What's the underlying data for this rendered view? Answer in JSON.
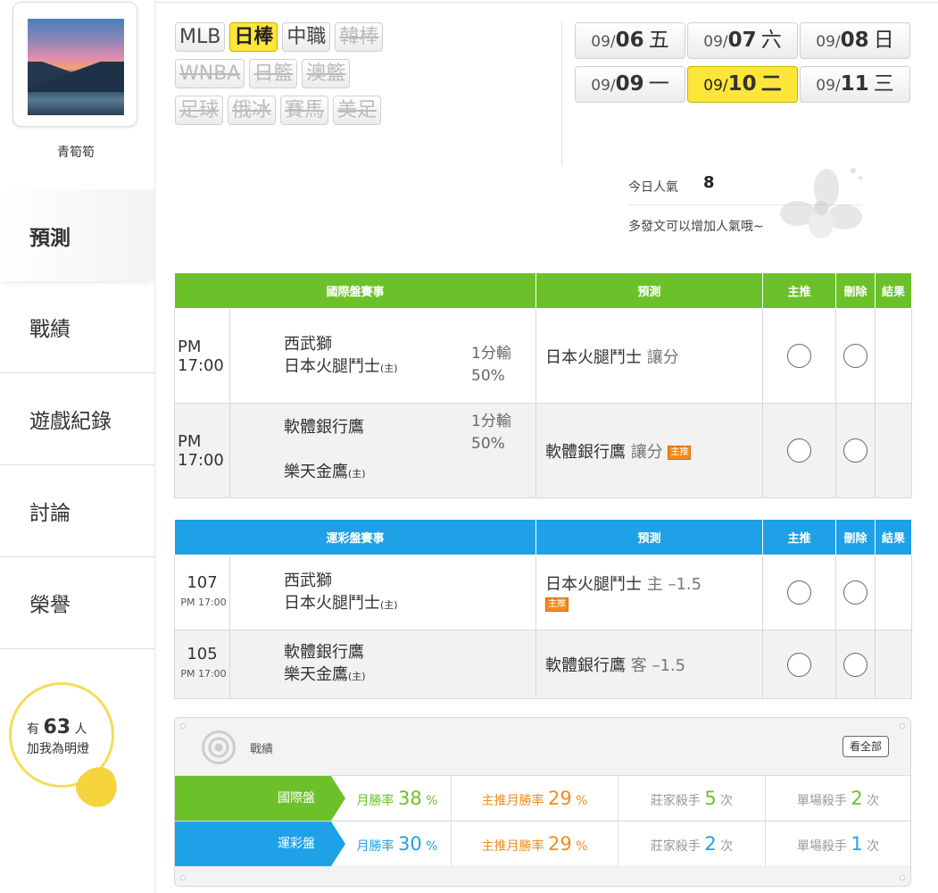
{
  "profile": {
    "username": "青筍筍"
  },
  "sidebar": {
    "items": [
      {
        "label": "預測",
        "active": true
      },
      {
        "label": "戰績"
      },
      {
        "label": "遊戲紀錄"
      },
      {
        "label": "討論"
      },
      {
        "label": "榮譽"
      }
    ],
    "fans": {
      "prefix": "有",
      "count": "63",
      "suffix": "人",
      "line2": "加我為明燈"
    }
  },
  "sports": [
    {
      "label": "MLB",
      "state": "normal"
    },
    {
      "label": "日棒",
      "state": "active"
    },
    {
      "label": "中職",
      "state": "normal"
    },
    {
      "label": "韓棒",
      "state": "disabled"
    },
    {
      "label": "WNBA",
      "state": "disabled"
    },
    {
      "label": "日籃",
      "state": "disabled"
    },
    {
      "label": "澳籃",
      "state": "disabled"
    },
    {
      "label": "足球",
      "state": "disabled"
    },
    {
      "label": "俄冰",
      "state": "disabled"
    },
    {
      "label": "賽馬",
      "state": "disabled"
    },
    {
      "label": "美足",
      "state": "disabled"
    }
  ],
  "dates": [
    {
      "month": "09/",
      "day": "06",
      "weekday": "五",
      "active": false
    },
    {
      "month": "09/",
      "day": "07",
      "weekday": "六",
      "active": false
    },
    {
      "month": "09/",
      "day": "08",
      "weekday": "日",
      "active": false
    },
    {
      "month": "09/",
      "day": "09",
      "weekday": "一",
      "active": false
    },
    {
      "month": "09/",
      "day": "10",
      "weekday": "二",
      "active": true
    },
    {
      "month": "09/",
      "day": "11",
      "weekday": "三",
      "active": false
    }
  ],
  "popularity": {
    "label": "今日人氣",
    "value": "8",
    "hint": "多發文可以增加人氣哦~"
  },
  "intl": {
    "headers": {
      "event": "國際盤賽事",
      "prediction": "預測",
      "main": "主推",
      "delete": "刪除",
      "result": "結果"
    },
    "rows": [
      {
        "time": "PM 17:00",
        "team1": "西武獅",
        "team1_host": "",
        "team2": "日本火腿鬥士",
        "team2_host": "(主)",
        "odds1": "1分輸",
        "odds2": "50%",
        "pred": "日本火腿鬥士",
        "pred_sub": "讓分",
        "tag": ""
      },
      {
        "time": "PM 17:00",
        "team1": "軟體銀行鷹",
        "team1_host": "",
        "team2": "樂天金鷹",
        "team2_host": "(主)",
        "odds1": "1分輸",
        "odds2": "50%",
        "pred": "軟體銀行鷹",
        "pred_sub": "讓分",
        "tag": "主推"
      }
    ]
  },
  "lottery": {
    "headers": {
      "event": "運彩盤賽事",
      "prediction": "預測",
      "main": "主推",
      "delete": "刪除",
      "result": "結果"
    },
    "rows": [
      {
        "no": "107",
        "time": "PM 17:00",
        "team1": "西武獅",
        "team2": "日本火腿鬥士",
        "team2_host": "(主)",
        "pred": "日本火腿鬥士",
        "pred_sub": "主 –1.5",
        "tag": "主推"
      },
      {
        "no": "105",
        "time": "PM 17:00",
        "team1": "軟體銀行鷹",
        "team2": "樂天金鷹",
        "team2_host": "(主)",
        "pred": "軟體銀行鷹",
        "pred_sub": "客 –1.5",
        "tag": ""
      }
    ]
  },
  "record": {
    "title": "戰績",
    "view_all": "看全部",
    "rows": [
      {
        "label": "國際盤",
        "color": "#6cc12a",
        "win_label": "月勝率",
        "win": "38",
        "main_label": "主推月勝率",
        "main": "29",
        "dealer_label": "莊家殺手",
        "dealer": "5",
        "single_label": "單場殺手",
        "single": "2",
        "pct": "%",
        "times": "次"
      },
      {
        "label": "運彩盤",
        "color": "#1ea1e6",
        "win_label": "月勝率",
        "win": "30",
        "main_label": "主推月勝率",
        "main": "29",
        "dealer_label": "莊家殺手",
        "dealer": "2",
        "single_label": "單場殺手",
        "single": "1",
        "pct": "%",
        "times": "次"
      }
    ]
  }
}
